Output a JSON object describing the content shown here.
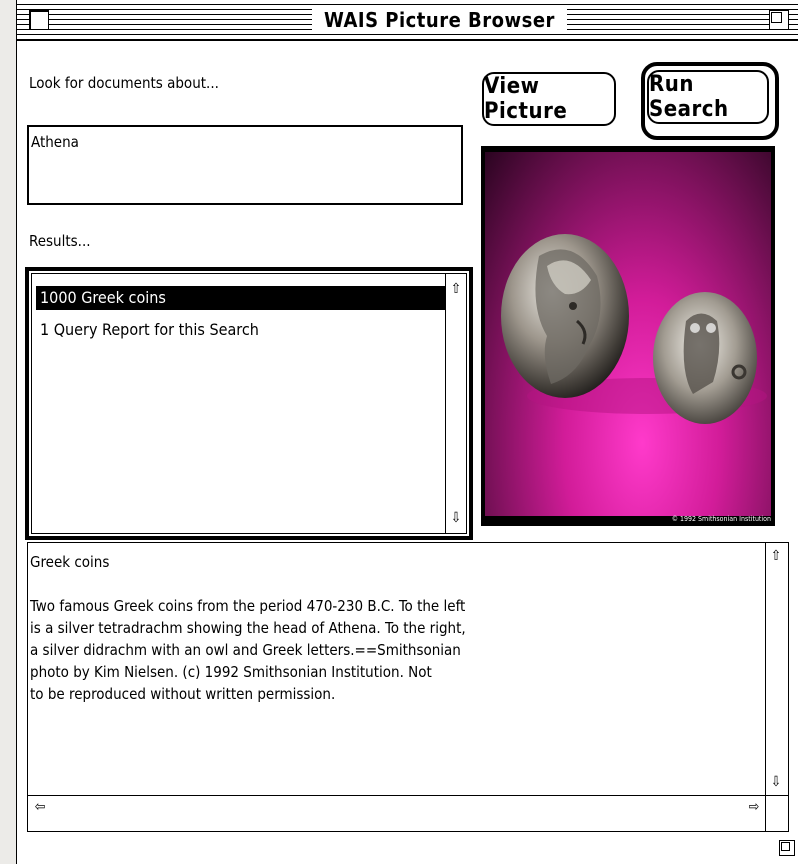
{
  "window": {
    "title": "WAIS Picture Browser"
  },
  "query": {
    "label": "Look for documents about...",
    "value": "Athena"
  },
  "buttons": {
    "view_picture": "View Picture",
    "run_search": "Run Search"
  },
  "results": {
    "label": "Results...",
    "items": [
      {
        "text": "1000  Greek coins",
        "selected": true
      },
      {
        "text": "1  Query Report for this Search",
        "selected": false
      }
    ]
  },
  "picture": {
    "caption": "© 1992 Smithsonian Institution"
  },
  "description": {
    "title": "Greek coins",
    "body": "Two famous Greek coins from the period 470-230 B.C.  To the left\nis a silver tetradrachm showing the head of Athena.  To the right,\na silver didrachm with an owl and Greek letters.==Smithsonian\nphoto by Kim Nielsen.  (c) 1992 Smithsonian Institution.  Not\nto be reproduced without written permission."
  },
  "icons": {
    "up": "arrow-up-icon",
    "down": "arrow-down-icon",
    "left": "arrow-left-icon",
    "right": "arrow-right-icon",
    "close": "close-box-icon",
    "zoom": "zoom-box-icon",
    "grow": "grow-box-icon"
  },
  "colors": {
    "selection": "#000000",
    "photo_background": "#d21c99"
  }
}
